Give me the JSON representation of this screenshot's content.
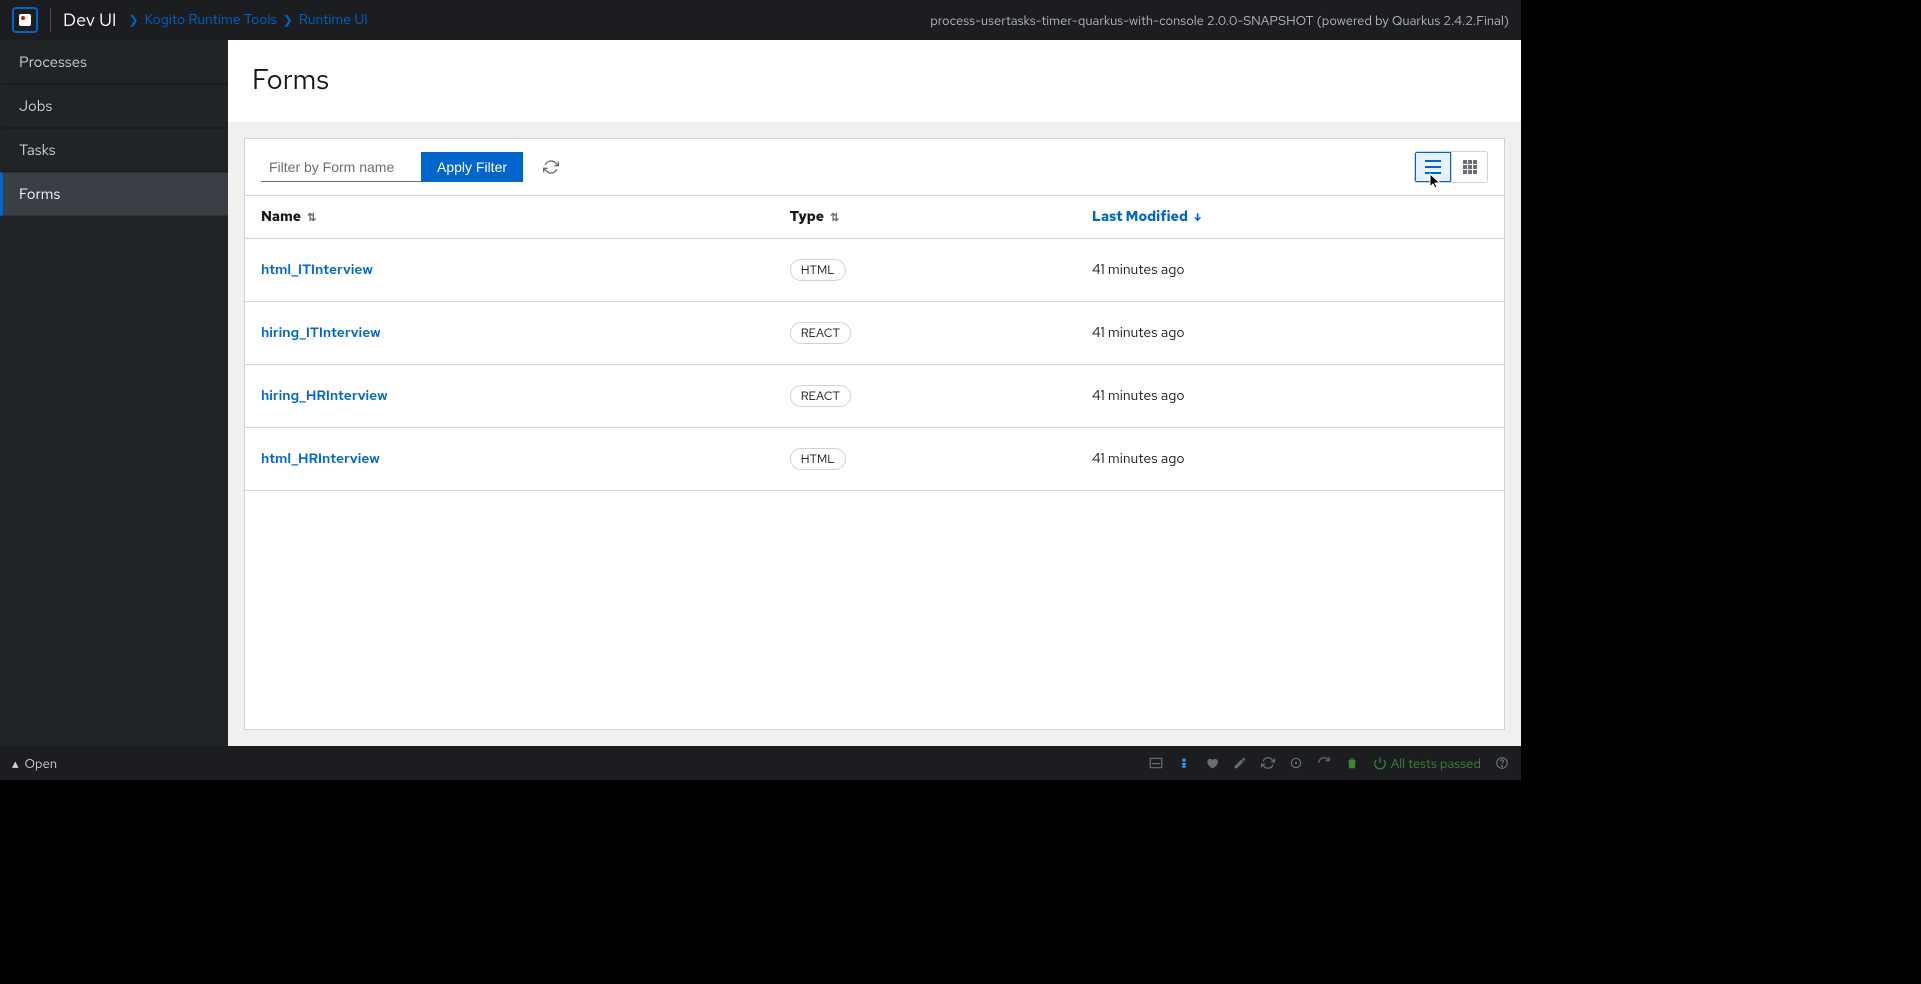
{
  "header": {
    "brand": "Dev UI",
    "breadcrumb": [
      "Kogito Runtime Tools",
      "Runtime UI"
    ],
    "app_info": "process-usertasks-timer-quarkus-with-console 2.0.0-SNAPSHOT (powered by Quarkus 2.4.2.Final)"
  },
  "sidebar": {
    "items": [
      {
        "label": "Processes",
        "active": false
      },
      {
        "label": "Jobs",
        "active": false
      },
      {
        "label": "Tasks",
        "active": false
      },
      {
        "label": "Forms",
        "active": true
      }
    ]
  },
  "page": {
    "title": "Forms"
  },
  "toolbar": {
    "filter_placeholder": "Filter by Form name",
    "filter_value": "",
    "apply_label": "Apply Filter",
    "refresh_icon": "sync-icon",
    "view_mode": "list"
  },
  "table": {
    "columns": [
      {
        "label": "Name",
        "sort": "none"
      },
      {
        "label": "Type",
        "sort": "none"
      },
      {
        "label": "Last Modified",
        "sort": "desc"
      }
    ],
    "rows": [
      {
        "name": "html_ITInterview",
        "type": "HTML",
        "modified": "41 minutes ago"
      },
      {
        "name": "hiring_ITInterview",
        "type": "REACT",
        "modified": "41 minutes ago"
      },
      {
        "name": "hiring_HRInterview",
        "type": "REACT",
        "modified": "41 minutes ago"
      },
      {
        "name": "html_HRInterview",
        "type": "HTML",
        "modified": "41 minutes ago"
      }
    ]
  },
  "statusbar": {
    "open_label": "Open",
    "tests_label": "All tests passed",
    "icons": [
      "terminal-icon",
      "person-icon",
      "heart-icon",
      "pencil-icon",
      "sync-icon",
      "target-icon",
      "redo-icon",
      "trash-icon"
    ]
  }
}
